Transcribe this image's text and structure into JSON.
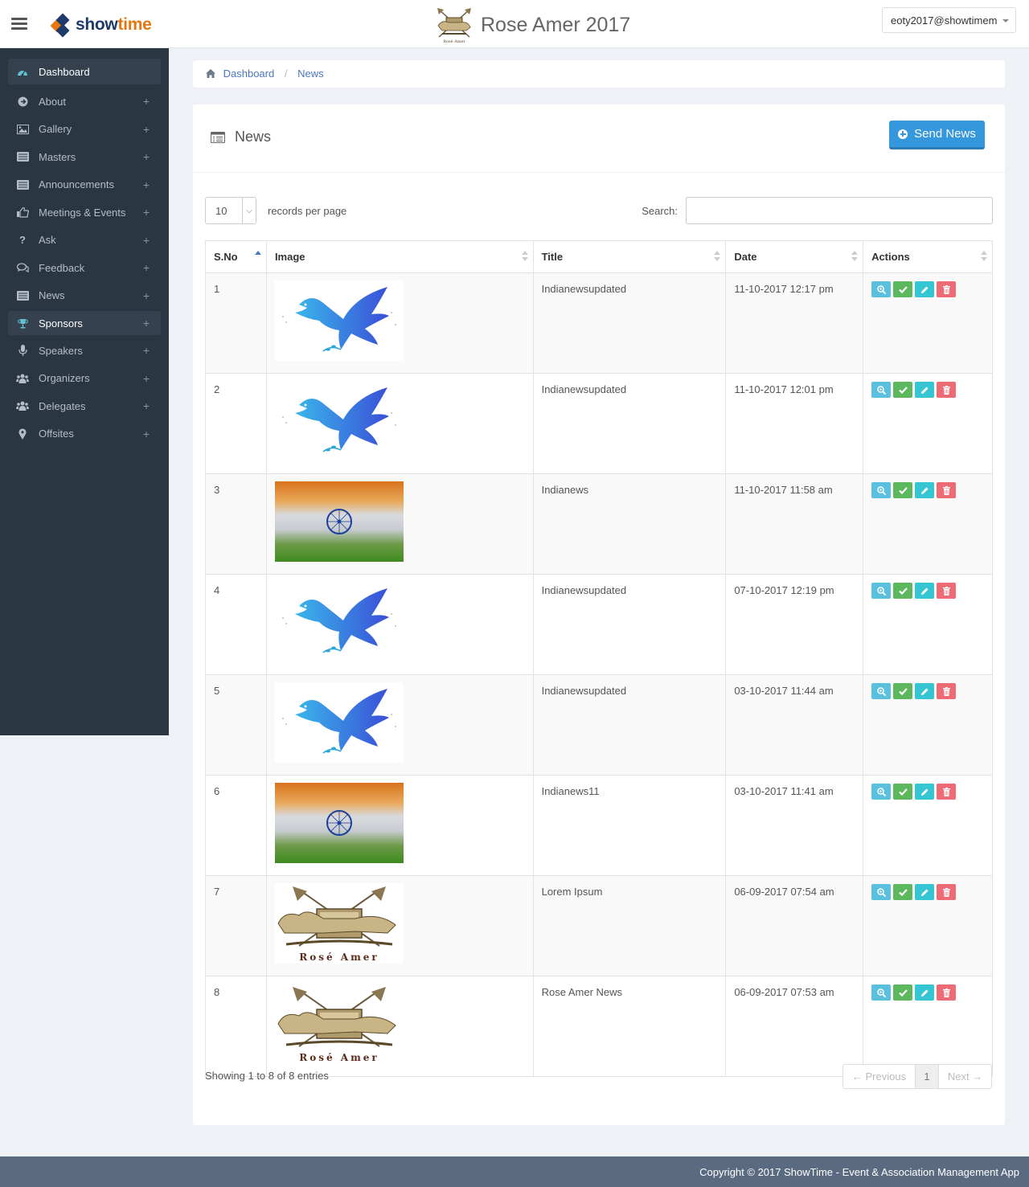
{
  "header": {
    "brand_a": "show",
    "brand_b": "time",
    "event_title": "Rose Amer 2017",
    "user": "eoty2017@showtimem"
  },
  "sidebar": {
    "items": [
      {
        "label": "Dashboard",
        "icon": "dashboard-icon"
      },
      {
        "label": "About",
        "icon": "arrow-circle-icon"
      },
      {
        "label": "Gallery",
        "icon": "image-icon"
      },
      {
        "label": "Masters",
        "icon": "list-icon"
      },
      {
        "label": "Announcements",
        "icon": "list-alt-icon"
      },
      {
        "label": "Meetings & Events",
        "icon": "thumbs-up-icon"
      },
      {
        "label": "Ask",
        "icon": "question-icon"
      },
      {
        "label": "Feedback",
        "icon": "comments-icon"
      },
      {
        "label": "News",
        "icon": "newspaper-icon"
      },
      {
        "label": "Sponsors",
        "icon": "trophy-icon"
      },
      {
        "label": "Speakers",
        "icon": "microphone-icon"
      },
      {
        "label": "Organizers",
        "icon": "users-icon"
      },
      {
        "label": "Delegates",
        "icon": "users-icon"
      },
      {
        "label": "Offsites",
        "icon": "map-marker-icon"
      }
    ]
  },
  "breadcrumb": {
    "home": "Dashboard",
    "sep": "/",
    "current": "News"
  },
  "portlet": {
    "title": "News",
    "send_label": "Send News"
  },
  "table_controls": {
    "length_value": "10",
    "length_label": "records per page",
    "search_label": "Search:"
  },
  "table": {
    "headers": [
      "S.No",
      "Image",
      "Title",
      "Date",
      "Actions"
    ],
    "rows": [
      {
        "sno": "1",
        "image": "dove",
        "title": "Indianewsupdated",
        "date": "11-10-2017 12:17 pm"
      },
      {
        "sno": "2",
        "image": "dove",
        "title": "Indianewsupdated",
        "date": "11-10-2017 12:01 pm"
      },
      {
        "sno": "3",
        "image": "flag",
        "title": "Indianews",
        "date": "11-10-2017 11:58 am"
      },
      {
        "sno": "4",
        "image": "dove",
        "title": "Indianewsupdated",
        "date": "07-10-2017 12:19 pm"
      },
      {
        "sno": "5",
        "image": "dove",
        "title": "Indianewsupdated",
        "date": "03-10-2017 11:44 am"
      },
      {
        "sno": "6",
        "image": "flag",
        "title": "Indianews11",
        "date": "03-10-2017 11:41 am"
      },
      {
        "sno": "7",
        "image": "crest",
        "title": "Lorem Ipsum",
        "date": "06-09-2017 07:54 am"
      },
      {
        "sno": "8",
        "image": "crest",
        "title": "Rose Amer News",
        "date": "06-09-2017 07:53 am"
      }
    ]
  },
  "footer_info": {
    "showing": "Showing 1 to 8 of 8 entries",
    "prev": "← Previous",
    "page": "1",
    "next": "Next →"
  },
  "footer": {
    "copyright": "Copyright © 2017 ShowTime - Event & Association Management App"
  },
  "crest_text": "Rosé Amer",
  "colors": {
    "sidebar": "#2b3643",
    "primary": "#3598dc",
    "view": "#5bc0de",
    "ok": "#5cb85c",
    "edit": "#36c6d3",
    "delete": "#ed6b75",
    "footer": "#5a6a80"
  }
}
